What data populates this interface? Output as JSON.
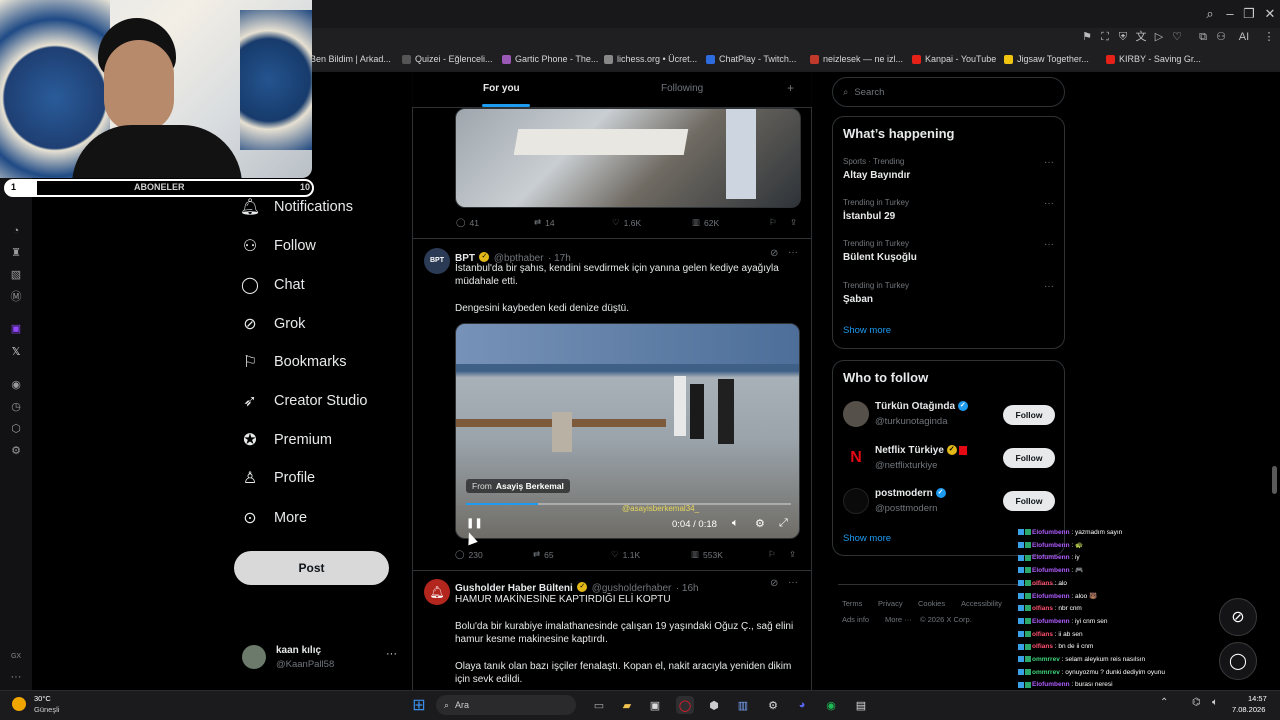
{
  "browser": {
    "bookmarks": [
      {
        "label": "Ben Bildim | Arkad...",
        "color": "#3b3b3b"
      },
      {
        "label": "Quizei - Eğlenceli...",
        "color": "#3b3b3b"
      },
      {
        "label": "Gartic Phone - The...",
        "color": "#9b59b6"
      },
      {
        "label": "lichess.org • Ücret...",
        "color": "#888888"
      },
      {
        "label": "ChatPlay - Twitch...",
        "color": "#2d6cdf"
      },
      {
        "label": "neizlesek — ne izl...",
        "color": "#c0392b"
      },
      {
        "label": "Kanpai - YouTube",
        "color": "#e62117"
      },
      {
        "label": "Jigsaw Together...",
        "color": "#f1c40f"
      },
      {
        "label": "KIRBY - Saving Gr...",
        "color": "#e62117"
      }
    ],
    "toolbar_ai": "AI"
  },
  "stream": {
    "subs_label": "ABONELER",
    "subs_left": "1",
    "subs_right": "10"
  },
  "nav": {
    "more_partial": "ore",
    "items": [
      {
        "label": "Notifications"
      },
      {
        "label": "Follow"
      },
      {
        "label": "Chat"
      },
      {
        "label": "Grok"
      },
      {
        "label": "Bookmarks"
      },
      {
        "label": "Creator Studio"
      },
      {
        "label": "Premium"
      },
      {
        "label": "Profile"
      },
      {
        "label": "More"
      }
    ],
    "post_label": "Post",
    "account": {
      "name": "kaan kılıç",
      "handle": "@KaanPall58"
    }
  },
  "feed": {
    "tabs": [
      "For you",
      "Following"
    ],
    "tweet1_stats": {
      "replies": "41",
      "retweets": "14",
      "likes": "1.6K",
      "views": "62K"
    },
    "tweet2": {
      "name": "BPT",
      "handle": "@bpthaber",
      "time": "· 17h",
      "text1": "İstanbul'da bir şahıs, kendini sevdirmek için yanına gelen kediye ayağıyla müdahale etti.",
      "text2": "Dengesini kaybeden kedi denize düştü.",
      "video_from": "From",
      "video_source": "Asayiş Berkemal",
      "video_watermark": "@asayisberkemal34_",
      "video_time": "0:04 / 0:18",
      "progress": 0.22,
      "stats": {
        "replies": "230",
        "retweets": "65",
        "likes": "1.1K",
        "views": "553K"
      }
    },
    "tweet3": {
      "name": "Gusholder Haber Bülteni",
      "handle": "@gusholderhaber",
      "time": "· 16h",
      "text1": "HAMUR MAKİNESİNE KAPTIRDIĞI ELİ KOPTU",
      "text2": "Bolu'da bir kurabiye imalathanesinde çalışan 19 yaşındaki Oğuz Ç., sağ elini hamur kesme makinesine kaptırdı.",
      "text3": "Olaya tanık olan bazı işçiler fenalaştı. Kopan el, nakit aracıyla yeniden dikim için sevk edildi."
    }
  },
  "right": {
    "search_placeholder": "Search",
    "happening_title": "What’s happening",
    "trends": [
      {
        "sub": "Sports · Trending",
        "title": "Altay Bayındır"
      },
      {
        "sub": "Trending in Turkey",
        "title": "İstanbul 29"
      },
      {
        "sub": "Trending in Turkey",
        "title": "Bülent Kuşoğlu"
      },
      {
        "sub": "Trending in Turkey",
        "title": "Şaban"
      }
    ],
    "show_more": "Show more",
    "who_title": "Who to follow",
    "follow_label": "Follow",
    "suggestions": [
      {
        "name": "Türkün Otağında",
        "handle": "@turkunotaginda"
      },
      {
        "name": "Netflix Türkiye",
        "handle": "@netflixturkiye"
      },
      {
        "name": "postmodern",
        "handle": "@posttmodern"
      }
    ],
    "footer": [
      "Terms",
      "Privacy",
      "Cookies",
      "Accessibility",
      "Ads info",
      "More ···",
      "© 2026 X Corp."
    ]
  },
  "chat": [
    {
      "user": "Elofumbenn",
      "msg": ": yazmadım sayın",
      "color": "#b05cff"
    },
    {
      "user": "Elofumbenn",
      "msg": ": 🐢",
      "color": "#b05cff"
    },
    {
      "user": "Elofumbenn",
      "msg": ": iy",
      "color": "#b05cff"
    },
    {
      "user": "Elofumbenn",
      "msg": ": 🎮",
      "color": "#b05cff"
    },
    {
      "user": "olfians",
      "msg": ": alo",
      "color": "#ff4f6d"
    },
    {
      "user": "Elofumbenn",
      "msg": ": aloo 🐻",
      "color": "#b05cff"
    },
    {
      "user": "olfians",
      "msg": ": nbr cnm",
      "color": "#ff4f6d"
    },
    {
      "user": "Elofumbenn",
      "msg": ": iyi cnm sen",
      "color": "#b05cff"
    },
    {
      "user": "olfians",
      "msg": ": ii ab sen",
      "color": "#ff4f6d"
    },
    {
      "user": "olfians",
      "msg": ": bn de ii cnm",
      "color": "#ff4f6d"
    },
    {
      "user": "ommrrev",
      "msg": ": selam aleykum reis nasılsın",
      "color": "#3fd47b"
    },
    {
      "user": "ommrrev",
      "msg": ": oynuyozmu ? dunki dediyim oyunu",
      "color": "#3fd47b"
    },
    {
      "user": "Elofumbenn",
      "msg": ": burası neresi",
      "color": "#b05cff"
    },
    {
      "user": "ommrrev",
      "msg": ": evet olm bende seni bekliyom oynamıycamu ?",
      "color": "#3fd47b"
    },
    {
      "user": "Elofumbenn",
      "msg": ": gerizekalı",
      "color": "#b05cff"
    }
  ],
  "taskbar": {
    "weather_temp": "30°C",
    "weather_desc": "Güneşli",
    "search": "Ara",
    "time": "14:57",
    "date": "7.08.2026",
    "gx": "GX"
  }
}
